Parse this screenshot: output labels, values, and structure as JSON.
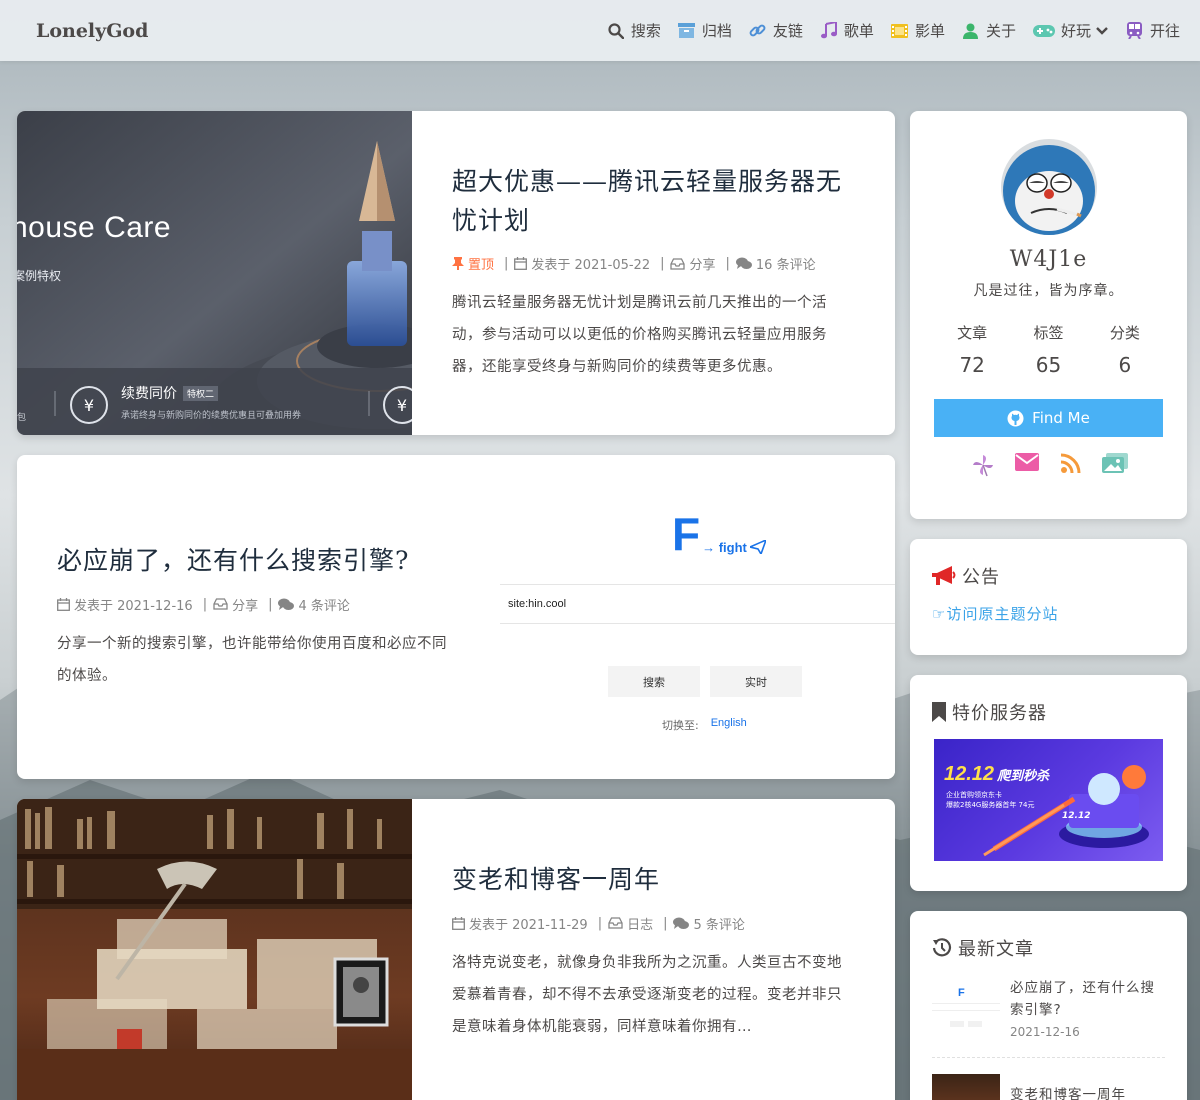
{
  "site": {
    "logo": "LonelyGod"
  },
  "nav": [
    {
      "label": "搜索",
      "icon": "search-icon"
    },
    {
      "label": "归档",
      "icon": "archive-icon"
    },
    {
      "label": "友链",
      "icon": "link-icon"
    },
    {
      "label": "歌单",
      "icon": "music-icon"
    },
    {
      "label": "影单",
      "icon": "film-icon"
    },
    {
      "label": "关于",
      "icon": "user-icon"
    },
    {
      "label": "好玩",
      "icon": "gamepad-icon"
    },
    {
      "label": "开往",
      "icon": "train-icon"
    }
  ],
  "posts": [
    {
      "title": "超大优惠——腾讯云轻量服务器无忧计划",
      "sticky_label": "置顶",
      "date": "发表于 2021-05-22",
      "category": "分享",
      "comments": "16 条评论",
      "excerpt": "腾讯云轻量服务器无忧计划是腾讯云前几天推出的一个活动，参与活动可以以更低的价格购买腾讯云轻量应用服务器，还能享受终身与新购同价的续费等更多优惠。",
      "cover": {
        "heading": "house Care",
        "sub": "案例特权",
        "badge_title": "续费同价",
        "badge_tag": "特权二",
        "badge_desc": "承诺终身与新购同价的续费优惠且可叠加用券",
        "badge_left": "包"
      }
    },
    {
      "title": "必应崩了，还有什么搜索引擎?",
      "date": "发表于 2021-12-16",
      "category": "分享",
      "comments": "4 条评论",
      "excerpt": "分享一个新的搜索引擎，也许能带给你使用百度和必应不同的体验。",
      "cover": {
        "logo_letter": "F",
        "logo_text": "→ fight",
        "search_value": "site:hin.cool",
        "btn_search": "搜索",
        "btn_live": "实时",
        "switch_label": "切换至:",
        "switch_lang": "English"
      }
    },
    {
      "title": "变老和博客一周年",
      "date": "发表于 2021-11-29",
      "category": "日志",
      "comments": "5 条评论",
      "excerpt": "洛特克说变老，就像身负非我所为之沉重。人类亘古不变地爱慕着青春，却不得不去承受逐渐变老的过程。变老并非只是意味着身体机能衰弱，同样意味着你拥有…"
    }
  ],
  "author": {
    "name": "W4J1e",
    "desc": "凡是过往，皆为序章。",
    "stats": [
      {
        "label": "文章",
        "value": "72"
      },
      {
        "label": "标签",
        "value": "65"
      },
      {
        "label": "分类",
        "value": "6"
      }
    ],
    "button": "Find Me",
    "social": [
      "pinwheel-icon",
      "mail-icon",
      "rss-icon",
      "gallery-icon"
    ]
  },
  "notice": {
    "title": "公告",
    "link": "☞访问原主题分站"
  },
  "server": {
    "title": "特价服务器",
    "banner_big": "12.12",
    "banner_hl": "爬到秒杀",
    "banner_l1": "企业首购领京东卡",
    "banner_l2": "爆款2核4G服务器首年 74元",
    "banner_tag": "12.12"
  },
  "recent": {
    "title": "最新文章",
    "items": [
      {
        "title": "必应崩了，还有什么搜索引擎?",
        "date": "2021-12-16"
      },
      {
        "title": "变老和博客一周年",
        "date": ""
      }
    ]
  },
  "colors": {
    "accent": "#49b1f5",
    "sticky": "#ff7242",
    "link": "#3ba3e8"
  }
}
